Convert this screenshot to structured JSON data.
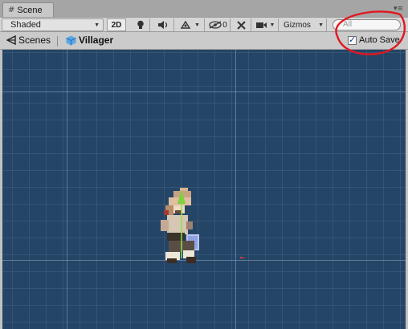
{
  "window": {
    "tab_title": "Scene",
    "tab_icon": "grid-icon",
    "menu_icon": "dropdown-menu-icon"
  },
  "toolbar": {
    "shading_mode": "Shaded",
    "mode_2d": "2D",
    "effects_count": "0",
    "gizmos_label": "Gizmos",
    "search_placeholder": "All"
  },
  "breadcrumb": {
    "scenes_label": "Scenes",
    "object_name": "Villager",
    "auto_save_label": "Auto Save",
    "auto_save_checked": true
  },
  "colors": {
    "viewport_bg": "#254567",
    "x_axis": "#e8452a",
    "y_axis": "#7fd23c",
    "annotation": "#e01820"
  }
}
